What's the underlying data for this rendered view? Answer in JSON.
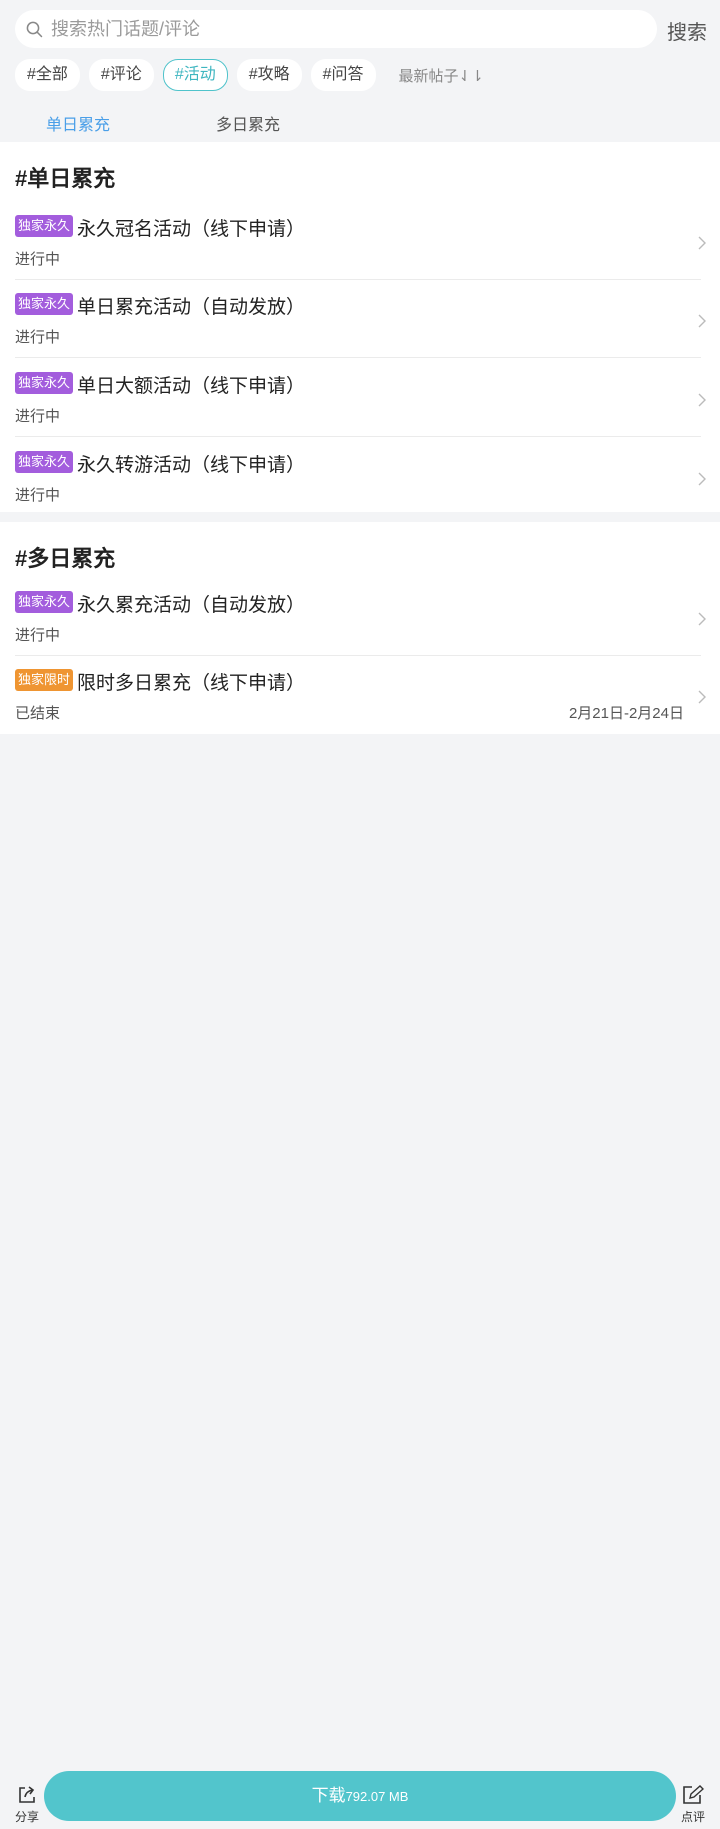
{
  "search": {
    "placeholder": "搜索热门话题/评论",
    "button_label": "搜索"
  },
  "tags": [
    {
      "label": "#全部",
      "active": false
    },
    {
      "label": "#评论",
      "active": false
    },
    {
      "label": "#活动",
      "active": true
    },
    {
      "label": "#攻略",
      "active": false
    },
    {
      "label": "#问答",
      "active": false
    }
  ],
  "sort_label": "最新帖子⇃⇂",
  "sub_tabs": [
    {
      "label": "单日累充",
      "active": true
    },
    {
      "label": "多日累充",
      "active": false
    }
  ],
  "colors": {
    "accent": "#52c5cc",
    "tab_active": "#4a9fe8",
    "badge_permanent": "#a35ddd",
    "badge_limited": "#ef9532"
  },
  "sections": [
    {
      "title": "#单日累充",
      "items": [
        {
          "badge": "独家永久",
          "title": "永久冠名活动（线下申请）",
          "status": "进行中"
        },
        {
          "badge": "独家永久",
          "title": "单日累充活动（自动发放）",
          "status": "进行中"
        },
        {
          "badge": "独家永久",
          "title": "单日大额活动（线下申请）",
          "status": "进行中"
        },
        {
          "badge": "独家永久",
          "title": "永久转游活动（线下申请）",
          "status": "进行中"
        }
      ]
    },
    {
      "title": "#多日累充",
      "items": [
        {
          "badge": "独家永久",
          "title": "永久累充活动（自动发放）",
          "status": "进行中"
        },
        {
          "badge": "独家限时",
          "title": "限时多日累充（线下申请）",
          "status": "已结束",
          "date": "2月21日-2月24日"
        }
      ]
    }
  ],
  "bottom_bar": {
    "share_label": "分享",
    "download_label": "下载",
    "download_size": "792.07 MB",
    "review_label": "点评"
  },
  "icons": {
    "search": "search-icon",
    "chevron": "chevron-right-icon",
    "share": "share-icon",
    "review": "edit-icon"
  }
}
